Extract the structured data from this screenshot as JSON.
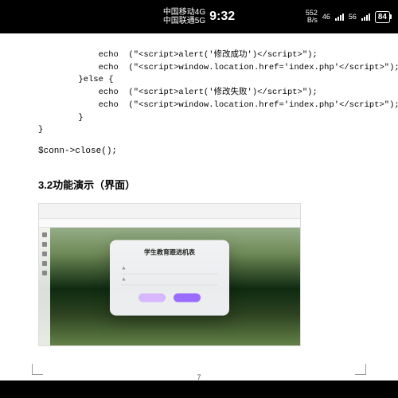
{
  "status": {
    "carrier1": "中国移动4G",
    "carrier2": "中国联通5G",
    "time": "9:32",
    "speed_value": "552",
    "speed_unit": "B/s",
    "net1": "46",
    "net2": "56",
    "battery": "84"
  },
  "code": {
    "l1": "            echo  (\"<script>alert('修改成功')</script>\");",
    "l2": "            echo  (\"<script>window.location.href='index.php'</script>\");",
    "l3": "        }else {",
    "l4": "            echo  (\"<script>alert('修改失败')</script>\");",
    "l5": "            echo  (\"<script>window.location.href='index.php'</script>\");",
    "l6": "        }",
    "l7": "}",
    "close": "$conn->close();"
  },
  "section_heading": "3.2功能演示（界面）",
  "card": {
    "title": "学生教育跟进机表",
    "field_icon": "▲",
    "btn1_label": "",
    "btn2_label": ""
  },
  "page_number": "7"
}
